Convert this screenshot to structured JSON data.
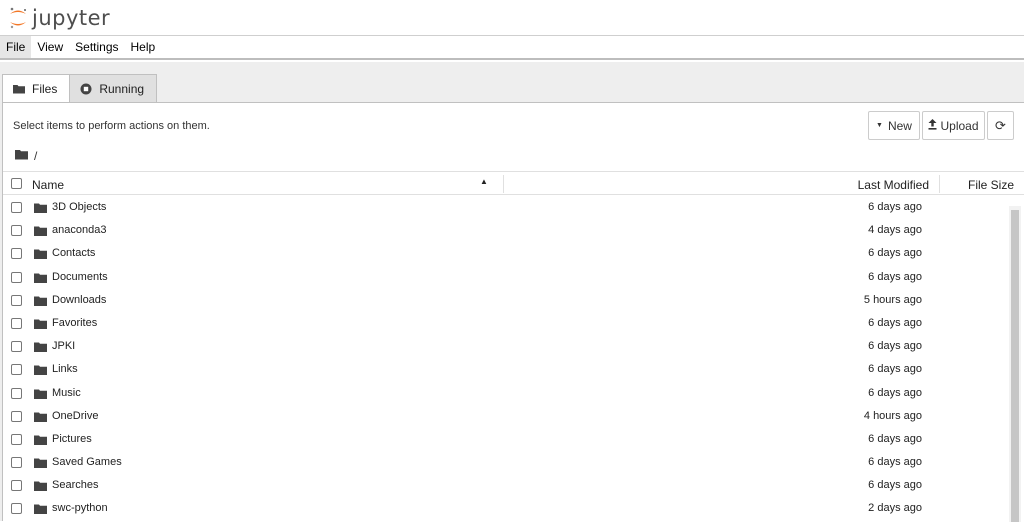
{
  "app": {
    "logo_text": "jupyter"
  },
  "menu": {
    "items": [
      "File",
      "View",
      "Settings",
      "Help"
    ]
  },
  "tabs": [
    {
      "label": "Files",
      "icon": "folder-icon",
      "active": true
    },
    {
      "label": "Running",
      "icon": "stop-circle-icon",
      "active": false
    }
  ],
  "toolbar": {
    "message": "Select items to perform actions on them.",
    "new_label": "New",
    "upload_label": "Upload",
    "refresh_icon": "refresh-icon"
  },
  "breadcrumb": {
    "path": "/"
  },
  "columns": {
    "name": "Name",
    "modified": "Last Modified",
    "size": "File Size"
  },
  "files": [
    {
      "name": "3D Objects",
      "modified": "6 days ago"
    },
    {
      "name": "anaconda3",
      "modified": "4 days ago"
    },
    {
      "name": "Contacts",
      "modified": "6 days ago"
    },
    {
      "name": "Documents",
      "modified": "6 days ago"
    },
    {
      "name": "Downloads",
      "modified": "5 hours ago"
    },
    {
      "name": "Favorites",
      "modified": "6 days ago"
    },
    {
      "name": "JPKI",
      "modified": "6 days ago"
    },
    {
      "name": "Links",
      "modified": "6 days ago"
    },
    {
      "name": "Music",
      "modified": "6 days ago"
    },
    {
      "name": "OneDrive",
      "modified": "4 hours ago"
    },
    {
      "name": "Pictures",
      "modified": "6 days ago"
    },
    {
      "name": "Saved Games",
      "modified": "6 days ago"
    },
    {
      "name": "Searches",
      "modified": "6 days ago"
    },
    {
      "name": "swc-python",
      "modified": "2 days ago"
    }
  ],
  "colors": {
    "logo_orange": "#f37726",
    "text": "#212121",
    "workspace_bg": "#eeeeee"
  }
}
